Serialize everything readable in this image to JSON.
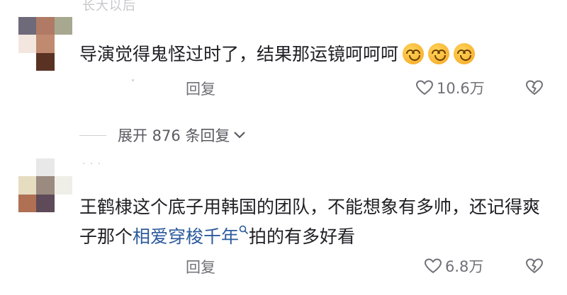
{
  "comments": [
    {
      "username": "长大以后",
      "text_before": "导演觉得鬼怪过时了，结果那运镜呵呵呵",
      "emoji_count": 3,
      "reply_label": "回复",
      "like_count": "10.6万"
    },
    {
      "username": "· · ·",
      "text_before": "王鹤棣这个底子用韩国的团队，不能想象有多帅，还记得爽子那个",
      "link_text": "相爱穿梭千年",
      "text_after": "拍的有多好看",
      "reply_label": "回复",
      "like_count": "6.8万"
    }
  ],
  "expand": {
    "label": "展开 876 条回复"
  },
  "icons": {
    "emoji": "upside-down-face-emoji",
    "like": "heart-outline-icon",
    "dislike": "broken-heart-icon",
    "expand": "chevron-down-icon",
    "search": "search-icon"
  },
  "colors": {
    "link": "#2b5a9c",
    "meta": "#707078",
    "text": "#1f1f24"
  }
}
